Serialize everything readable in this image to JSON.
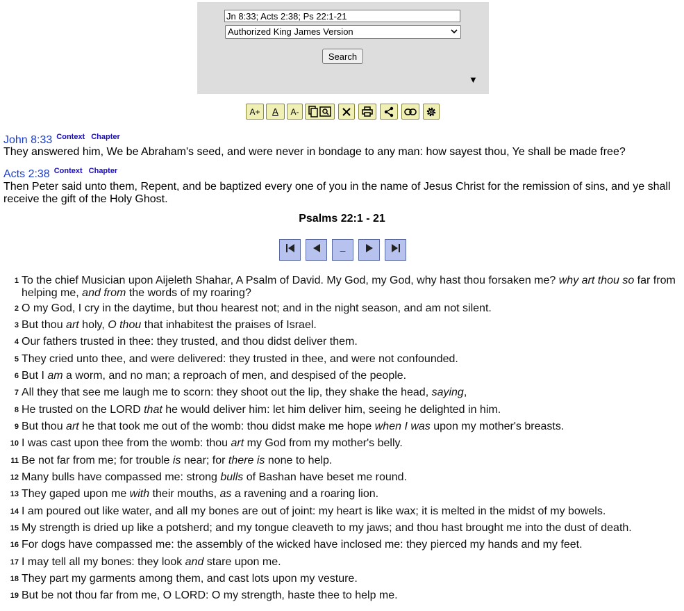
{
  "search": {
    "query_value": "Jn 8:33; Acts 2:38; Ps 22:1-21",
    "version_selected": "Authorized King James Version",
    "search_label": "Search",
    "toggle_glyph": "▼"
  },
  "toolbar": {
    "buttons": [
      {
        "name": "increase-font-button",
        "label": "A+",
        "icon": "font-increase-icon"
      },
      {
        "name": "font-style-button",
        "label": "A",
        "icon": "font-underline-icon"
      },
      {
        "name": "decrease-font-button",
        "label": "A-",
        "icon": "font-decrease-icon"
      },
      {
        "name": "compare-button",
        "label": "",
        "icon": "copy-search-icon"
      },
      {
        "name": "clear-button",
        "label": "",
        "icon": "close-icon"
      },
      {
        "name": "print-button",
        "label": "",
        "icon": "printer-icon"
      },
      {
        "name": "share-button",
        "label": "",
        "icon": "share-icon"
      },
      {
        "name": "link-button",
        "label": "",
        "icon": "link-icon"
      },
      {
        "name": "settings-button",
        "label": "",
        "icon": "gear-icon"
      }
    ]
  },
  "references": [
    {
      "title": "John 8:33",
      "context_label": "Context",
      "chapter_label": "Chapter",
      "text": "They answered him, We be Abraham's seed, and were never in bondage to any man: how sayest thou, Ye shall be made free?"
    },
    {
      "title": "Acts 2:38",
      "context_label": "Context",
      "chapter_label": "Chapter",
      "text": "Then Peter said unto them, Repent, and be baptized every one of you in the name of Jesus Christ for the remission of sins, and ye shall receive the gift of the Holy Ghost."
    }
  ],
  "passage": {
    "title": "Psalms 22:1 - 21",
    "nav": [
      {
        "name": "first-chapter-button",
        "icon": "skip-first-icon"
      },
      {
        "name": "previous-chapter-button",
        "icon": "triangle-left-icon"
      },
      {
        "name": "current-chapter-button",
        "icon": "dash-icon",
        "glyph": "–"
      },
      {
        "name": "next-chapter-button",
        "icon": "triangle-right-icon"
      },
      {
        "name": "last-chapter-button",
        "icon": "skip-last-icon"
      }
    ],
    "verses": [
      {
        "num": "1",
        "html": "To the chief Musician upon Aijeleth Shahar, A Psalm of David. My God, my God, why hast thou forsaken me? <i>why art thou so</i> far from helping me, <i>and from</i> the words of my roaring?"
      },
      {
        "num": "2",
        "html": "O my God, I cry in the daytime, but thou hearest not; and in the night season, and am not silent."
      },
      {
        "num": "3",
        "html": "But thou <i>art</i> holy, <i>O thou</i> that inhabitest the praises of Israel."
      },
      {
        "num": "4",
        "html": "Our fathers trusted in thee: they trusted, and thou didst deliver them."
      },
      {
        "num": "5",
        "html": "They cried unto thee, and were delivered: they trusted in thee, and were not confounded."
      },
      {
        "num": "6",
        "html": "But I <i>am</i> a worm, and no man; a reproach of men, and despised of the people."
      },
      {
        "num": "7",
        "html": "All they that see me laugh me to scorn: they shoot out the lip, they shake the head, <i>saying</i>,"
      },
      {
        "num": "8",
        "html": "He trusted on the LORD <i>that</i> he would deliver him: let him deliver him, seeing he delighted in him."
      },
      {
        "num": "9",
        "html": "But thou <i>art</i> he that took me out of the womb: thou didst make me hope <i>when I was</i> upon my mother's breasts."
      },
      {
        "num": "10",
        "html": "I was cast upon thee from the womb: thou <i>art</i> my God from my mother's belly."
      },
      {
        "num": "11",
        "html": "Be not far from me; for trouble <i>is</i> near; for <i>there is</i> none to help."
      },
      {
        "num": "12",
        "html": "Many bulls have compassed me: strong <i>bulls</i> of Bashan have beset me round."
      },
      {
        "num": "13",
        "html": "They gaped upon me <i>with</i> their mouths, <i>as</i> a ravening and a roaring lion."
      },
      {
        "num": "14",
        "html": "I am poured out like water, and all my bones are out of joint: my heart is like wax; it is melted in the midst of my bowels."
      },
      {
        "num": "15",
        "html": "My strength is dried up like a potsherd; and my tongue cleaveth to my jaws; and thou hast brought me into the dust of death."
      },
      {
        "num": "16",
        "html": "For dogs have compassed me: the assembly of the wicked have inclosed me: they pierced my hands and my feet."
      },
      {
        "num": "17",
        "html": "I may tell all my bones: they look <i>and</i> stare upon me."
      },
      {
        "num": "18",
        "html": "They part my garments among them, and cast lots upon my vesture."
      },
      {
        "num": "19",
        "html": "But be not thou far from me, O LORD: O my strength, haste thee to help me."
      }
    ]
  }
}
